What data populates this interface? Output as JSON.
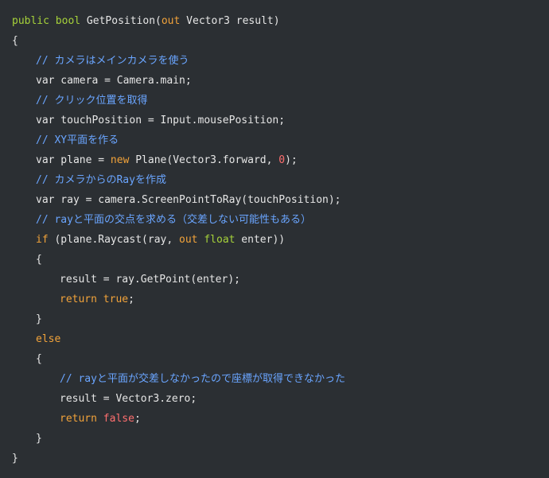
{
  "code": {
    "lines": [
      {
        "indent": 0,
        "tokens": [
          {
            "t": "public",
            "c": "kw-green"
          },
          {
            "t": " ",
            "c": "plain"
          },
          {
            "t": "bool",
            "c": "kw-green"
          },
          {
            "t": " GetPosition(",
            "c": "plain"
          },
          {
            "t": "out",
            "c": "kw-orange"
          },
          {
            "t": " Vector3 result)",
            "c": "plain"
          }
        ]
      },
      {
        "indent": 0,
        "tokens": [
          {
            "t": "{",
            "c": "plain"
          }
        ]
      },
      {
        "indent": 1,
        "tokens": [
          {
            "t": "// カメラはメインカメラを使う",
            "c": "comment"
          }
        ]
      },
      {
        "indent": 1,
        "tokens": [
          {
            "t": "var camera = Camera.main;",
            "c": "plain"
          }
        ]
      },
      {
        "indent": 1,
        "tokens": [
          {
            "t": "// クリック位置を取得",
            "c": "comment"
          }
        ]
      },
      {
        "indent": 1,
        "tokens": [
          {
            "t": "var touchPosition = Input.mousePosition;",
            "c": "plain"
          }
        ]
      },
      {
        "indent": 1,
        "tokens": [
          {
            "t": "// XY平面を作る",
            "c": "comment"
          }
        ]
      },
      {
        "indent": 1,
        "tokens": [
          {
            "t": "var plane = ",
            "c": "plain"
          },
          {
            "t": "new",
            "c": "kw-orange"
          },
          {
            "t": " Plane(Vector3.forward, ",
            "c": "plain"
          },
          {
            "t": "0",
            "c": "kw-red"
          },
          {
            "t": ");",
            "c": "plain"
          }
        ]
      },
      {
        "indent": 1,
        "tokens": [
          {
            "t": "// カメラからのRayを作成",
            "c": "comment"
          }
        ]
      },
      {
        "indent": 1,
        "tokens": [
          {
            "t": "var ray = camera.ScreenPointToRay(touchPosition);",
            "c": "plain"
          }
        ]
      },
      {
        "indent": 1,
        "tokens": [
          {
            "t": "// rayと平面の交点を求める（交差しない可能性もある）",
            "c": "comment"
          }
        ]
      },
      {
        "indent": 1,
        "tokens": [
          {
            "t": "if",
            "c": "kw-orange"
          },
          {
            "t": " (plane.Raycast(ray, ",
            "c": "plain"
          },
          {
            "t": "out",
            "c": "kw-orange"
          },
          {
            "t": " ",
            "c": "plain"
          },
          {
            "t": "float",
            "c": "kw-green"
          },
          {
            "t": " enter))",
            "c": "plain"
          }
        ]
      },
      {
        "indent": 1,
        "tokens": [
          {
            "t": "{",
            "c": "plain"
          }
        ]
      },
      {
        "indent": 2,
        "tokens": [
          {
            "t": "result = ray.GetPoint(enter);",
            "c": "plain"
          }
        ]
      },
      {
        "indent": 2,
        "tokens": [
          {
            "t": "return",
            "c": "kw-orange"
          },
          {
            "t": " ",
            "c": "plain"
          },
          {
            "t": "true",
            "c": "kw-orange"
          },
          {
            "t": ";",
            "c": "plain"
          }
        ]
      },
      {
        "indent": 1,
        "tokens": [
          {
            "t": "}",
            "c": "plain"
          }
        ]
      },
      {
        "indent": 1,
        "tokens": [
          {
            "t": "else",
            "c": "kw-orange"
          }
        ]
      },
      {
        "indent": 1,
        "tokens": [
          {
            "t": "{",
            "c": "plain"
          }
        ]
      },
      {
        "indent": 2,
        "tokens": [
          {
            "t": "// rayと平面が交差しなかったので座標が取得できなかった",
            "c": "comment"
          }
        ]
      },
      {
        "indent": 2,
        "tokens": [
          {
            "t": "result = Vector3.zero;",
            "c": "plain"
          }
        ]
      },
      {
        "indent": 2,
        "tokens": [
          {
            "t": "return",
            "c": "kw-orange"
          },
          {
            "t": " ",
            "c": "plain"
          },
          {
            "t": "false",
            "c": "kw-red"
          },
          {
            "t": ";",
            "c": "plain"
          }
        ]
      },
      {
        "indent": 1,
        "tokens": [
          {
            "t": "}",
            "c": "plain"
          }
        ]
      },
      {
        "indent": 0,
        "tokens": [
          {
            "t": "}",
            "c": "plain"
          }
        ]
      }
    ]
  },
  "colors": {
    "background": "#2b2f33",
    "plain": "#e6e6e6",
    "keyword_green": "#a6d23a",
    "keyword_orange": "#f2a33a",
    "literal_red": "#ff6f6f",
    "comment": "#6aa5ff"
  }
}
